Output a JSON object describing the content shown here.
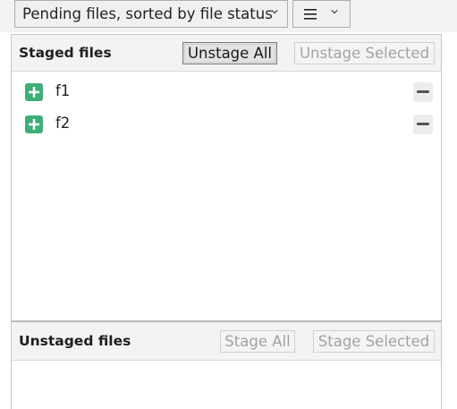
{
  "toolbar": {
    "view_select_value": "Pending files, sorted by file status",
    "list_toggle_icon": "list-icon"
  },
  "staged": {
    "title": "Staged files",
    "unstage_all_label": "Unstage All",
    "unstage_selected_label": "Unstage Selected",
    "files": [
      {
        "name": "f1",
        "status_icon": "plus-icon",
        "action_icon": "minus-icon"
      },
      {
        "name": "f2",
        "status_icon": "plus-icon",
        "action_icon": "minus-icon"
      }
    ]
  },
  "unstaged": {
    "title": "Unstaged files",
    "stage_all_label": "Stage All",
    "stage_selected_label": "Stage Selected",
    "files": []
  },
  "colors": {
    "added_green": "#3dae77",
    "header_bg": "#f3f3f3",
    "disabled_text": "#a3a3a3"
  }
}
